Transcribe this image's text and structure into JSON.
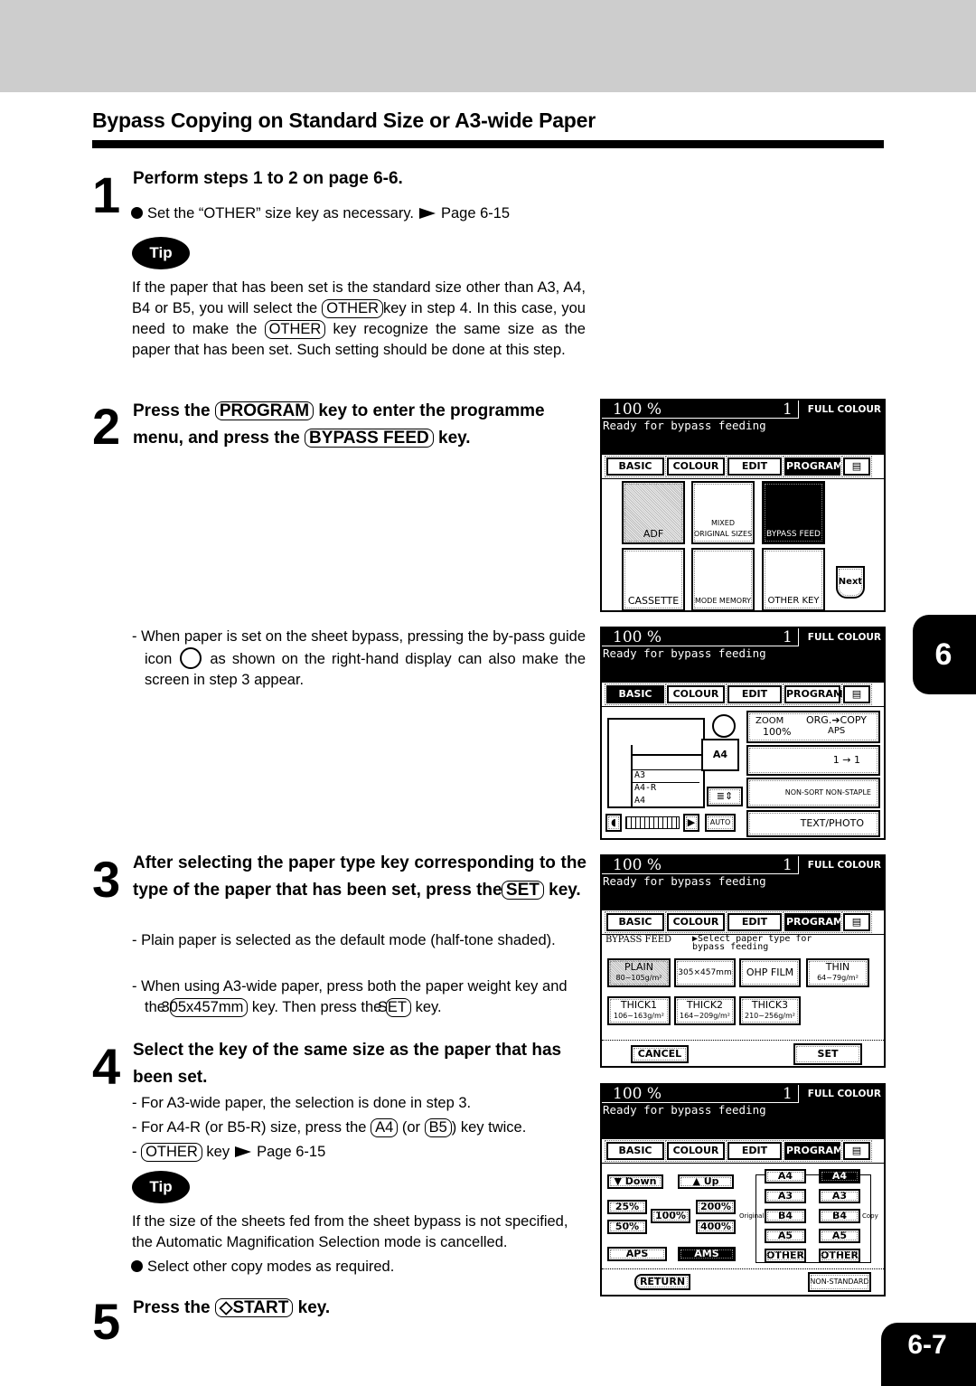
{
  "page": {
    "title": "Bypass Copying on Standard Size or A3-wide Paper",
    "chapter_tab": "6",
    "page_number": "6-7"
  },
  "steps": [
    {
      "number": "1",
      "heading": "Perform steps 1 to 2 on page 6-6.",
      "bullet_pre": "Set the “OTHER” size key as necessary.",
      "bullet_ref": "Page 6-15",
      "tip_label": "Tip",
      "tip_parts": [
        "If the paper that has been set is the standard size other than A3, A4, B4 or B5, you will select the ",
        "OTHER",
        "key in step 4.  In this case, you need to make the ",
        "OTHER",
        " key recognize the same size as the paper that has been set. Such setting should be done at this step."
      ]
    },
    {
      "number": "2",
      "heading_parts": [
        "Press the ",
        "PROGRAM",
        " key to enter the programme menu, and press the ",
        "BYPASS FEED",
        " key."
      ],
      "note_pre": "- When paper is set on the sheet bypass, pressing the by-pass guide icon ",
      "note_post": " as shown on the right-hand display can also make the screen in step 3 appear."
    },
    {
      "number": "3",
      "heading_parts": [
        "After selecting the paper type key corresponding to the type of the paper that has been set, press the ",
        "SET",
        " key."
      ],
      "notes": [
        "- Plain paper is selected as the default mode (half-tone shaded).",
        "- When using A3-wide paper, press both the paper weight key and the "
      ],
      "note2_key1": "305x457mm",
      "note2_mid": " key.  Then press the ",
      "note2_key2": "SET",
      "note2_end": " key."
    },
    {
      "number": "4",
      "heading": "Select the key of the same size as the paper that has been set.",
      "note1": "- For A3-wide paper, the selection is done in step 3.",
      "note2_pre": "- For A4-R (or B5-R) size, press the ",
      "note2_key1": "A4",
      "note2_mid": " (or ",
      "note2_key2": "B5",
      "note2_end": ") key twice.",
      "note3_pre": "- ",
      "note3_key": "OTHER",
      "note3_mid": " key",
      "note3_ref": "Page 6-15",
      "tip_label": "Tip",
      "tip_text": "If the size of the sheets fed from the sheet bypass is not specified, the Automatic Magnification Selection mode is cancelled.",
      "bullet": "Select other copy modes as required."
    },
    {
      "number": "5",
      "heading_pre": "Press the ",
      "heading_key": "◇START",
      "heading_post": " key."
    }
  ],
  "screen_common": {
    "zoom": "100  %",
    "count": "1",
    "mode": "FULL COLOUR",
    "status": "Ready for bypass feeding",
    "tabs": [
      "BASIC",
      "COLOUR",
      "EDIT",
      "PROGRAM",
      "▤"
    ]
  },
  "screen1": {
    "buttons": [
      "ADF",
      "MIXED ORIGINAL SIZES",
      "BYPASS FEED",
      "CASSETTE",
      "MODE MEMORY",
      "OTHER KEY",
      "Next"
    ]
  },
  "screen2": {
    "trays": [
      "A4",
      "A3",
      "A4-R",
      "A4"
    ],
    "zoom_label": "ZOOM",
    "zoom_value": "100%",
    "org_copy": "ORG.➔COPY",
    "aps": "APS",
    "duplex": "1 → 1",
    "finisher": "NON-SORT NON-STAPLE",
    "auto": "AUTO",
    "image_mode": "TEXT/PHOTO"
  },
  "screen3": {
    "label": "BYPASS FEED",
    "prompt": "▶Select paper type for bypass feeding",
    "types": [
      {
        "name": "PLAIN",
        "weight": "80~105g/m²"
      },
      {
        "name": "305×457mm",
        "weight": ""
      },
      {
        "name": "OHP FILM",
        "weight": ""
      },
      {
        "name": "THIN",
        "weight": "64~79g/m²"
      },
      {
        "name": "THICK1",
        "weight": "106~163g/m²"
      },
      {
        "name": "THICK2",
        "weight": "164~209g/m²"
      },
      {
        "name": "THICK3",
        "weight": "210~256g/m²"
      }
    ],
    "cancel": "CANCEL",
    "set": "SET"
  },
  "screen4": {
    "down": "▼ Down",
    "up": "▲ Up",
    "ratios": [
      "25%",
      "50%",
      "100%",
      "200%",
      "400%"
    ],
    "aps": "APS",
    "ams": "AMS",
    "original_label": "Original",
    "copy_label": "Copy",
    "original_sizes": [
      "A4",
      "A3",
      "B4",
      "A5",
      "OTHER"
    ],
    "copy_sizes": [
      "A4",
      "A3",
      "B4",
      "A5",
      "OTHER"
    ],
    "return": "RETURN",
    "non_standard": "NON-STANDARD"
  }
}
